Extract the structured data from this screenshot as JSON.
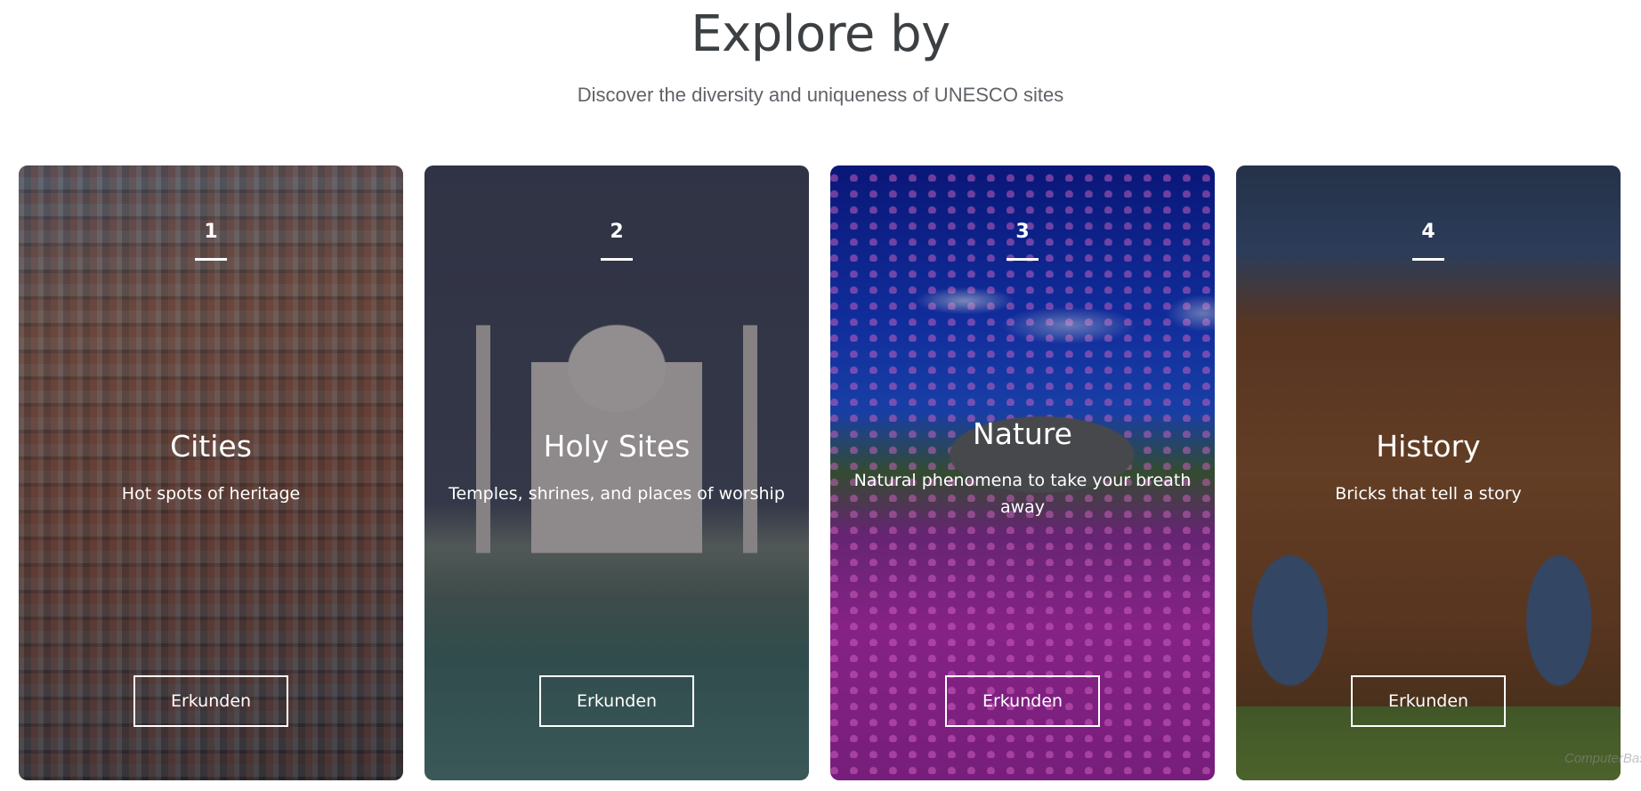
{
  "header": {
    "title": "Explore by",
    "subtitle": "Discover the diversity and uniqueness of UNESCO sites"
  },
  "cards": [
    {
      "number": "1",
      "title": "Cities",
      "description": "Hot spots of heritage",
      "button_label": "Erkunden"
    },
    {
      "number": "2",
      "title": "Holy Sites",
      "description": "Temples, shrines, and places of worship",
      "button_label": "Erkunden"
    },
    {
      "number": "3",
      "title": "Nature",
      "description": "Natural phenomena to take your breath away",
      "button_label": "Erkunden"
    },
    {
      "number": "4",
      "title": "History",
      "description": "Bricks that tell a story",
      "button_label": "Erkunden"
    }
  ],
  "watermark": {
    "text": "ComputerBase"
  }
}
